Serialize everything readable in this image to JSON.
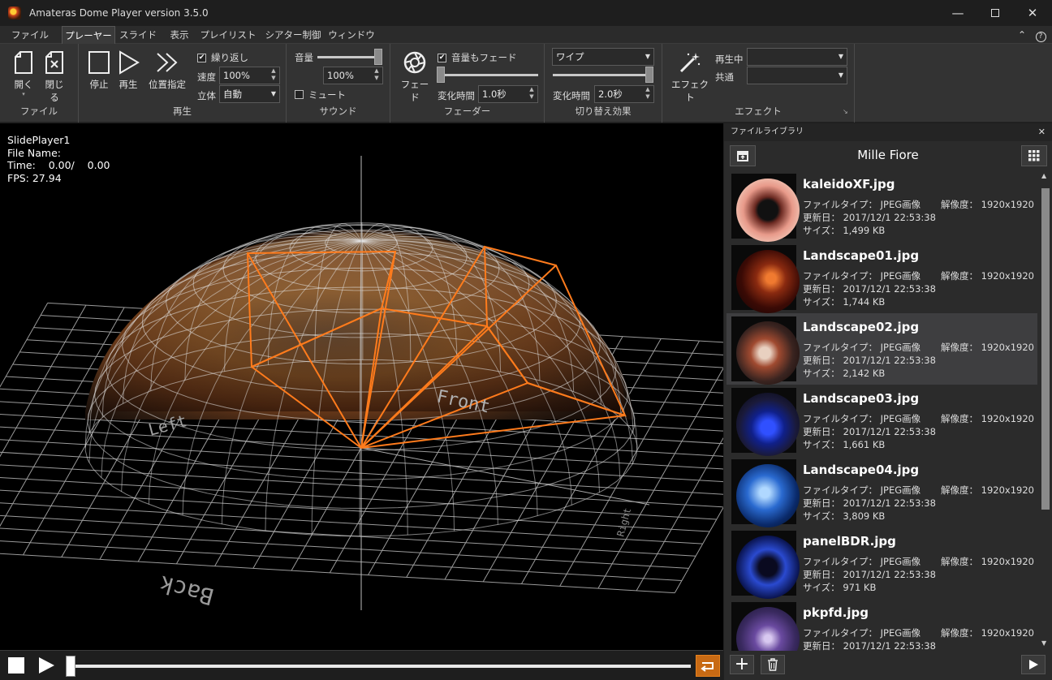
{
  "window": {
    "title": "Amateras Dome Player version 3.5.0",
    "minimize_icon": "minimize-icon",
    "maximize_icon": "maximize-icon",
    "close_icon": "close-icon"
  },
  "menu": {
    "tabs": [
      "ファイル",
      "プレーヤー",
      "スライド",
      "表示",
      "プレイリスト",
      "シアター制御",
      "ウィンドウ"
    ],
    "active": "プレーヤー"
  },
  "ribbon": {
    "file_group": {
      "label": "ファイル",
      "open": "開く",
      "close": "閉じる"
    },
    "play_group": {
      "label": "再生",
      "stop": "停止",
      "play": "再生",
      "seek": "位置指定",
      "loop": "繰り返し",
      "loop_checked": true,
      "speed_label": "速度",
      "speed_value": "100%",
      "stereo_label": "立体",
      "stereo_value": "自動"
    },
    "sound_group": {
      "label": "サウンド",
      "volume_label": "音量",
      "volume_value": "100%",
      "volume_level": 1.0,
      "mute": "ミュート",
      "mute_checked": false
    },
    "fader_group": {
      "label": "フェーダー",
      "fade": "フェード",
      "fade_volume": "音量もフェード",
      "fade_volume_checked": true,
      "time_label": "変化時間",
      "time_value": "1.0秒"
    },
    "transition_group": {
      "label": "切り替え効果",
      "effect_value": "ワイプ",
      "time_label": "変化時間",
      "time_value": "2.0秒"
    },
    "effect_group": {
      "label": "エフェクト",
      "effect": "エフェクト",
      "playing_label": "再生中",
      "common_label": "共通",
      "playing_value": "",
      "common_value": ""
    }
  },
  "player": {
    "name": "SlidePlayer1",
    "file_label": "File Name:",
    "time_label": "Time:",
    "time_current": "0.00/",
    "time_total": "0.00",
    "fps_label": "FPS:",
    "fps_value": "27.94",
    "dome_labels": {
      "front": "Front",
      "left": "Left",
      "back": "Back",
      "right": "Right"
    },
    "progress": 0.0
  },
  "library": {
    "panel_title": "ファイルライブラリ",
    "title": "Mille Fiore",
    "items": [
      {
        "name": "kaleidoXF.jpg",
        "type_label": "ファイルタイプ：",
        "type": "JPEG画像",
        "date_label": "更新日：",
        "date": "2017/12/1 22:53:38",
        "size_label": "サイズ：",
        "size": "1,499 KB",
        "res_label": "解像度：",
        "res": "1920x1920",
        "selected": false
      },
      {
        "name": "Landscape01.jpg",
        "type_label": "ファイルタイプ：",
        "type": "JPEG画像",
        "date_label": "更新日：",
        "date": "2017/12/1 22:53:38",
        "size_label": "サイズ：",
        "size": "1,744 KB",
        "res_label": "解像度：",
        "res": "1920x1920",
        "selected": false
      },
      {
        "name": "Landscape02.jpg",
        "type_label": "ファイルタイプ：",
        "type": "JPEG画像",
        "date_label": "更新日：",
        "date": "2017/12/1 22:53:38",
        "size_label": "サイズ：",
        "size": "2,142 KB",
        "res_label": "解像度：",
        "res": "1920x1920",
        "selected": true
      },
      {
        "name": "Landscape03.jpg",
        "type_label": "ファイルタイプ：",
        "type": "JPEG画像",
        "date_label": "更新日：",
        "date": "2017/12/1 22:53:38",
        "size_label": "サイズ：",
        "size": "1,661 KB",
        "res_label": "解像度：",
        "res": "1920x1920",
        "selected": false
      },
      {
        "name": "Landscape04.jpg",
        "type_label": "ファイルタイプ：",
        "type": "JPEG画像",
        "date_label": "更新日：",
        "date": "2017/12/1 22:53:38",
        "size_label": "サイズ：",
        "size": "3,809 KB",
        "res_label": "解像度：",
        "res": "1920x1920",
        "selected": false
      },
      {
        "name": "panelBDR.jpg",
        "type_label": "ファイルタイプ：",
        "type": "JPEG画像",
        "date_label": "更新日：",
        "date": "2017/12/1 22:53:38",
        "size_label": "サイズ：",
        "size": "971 KB",
        "res_label": "解像度：",
        "res": "1920x1920",
        "selected": false
      },
      {
        "name": "pkpfd.jpg",
        "type_label": "ファイルタイプ：",
        "type": "JPEG画像",
        "date_label": "更新日：",
        "date": "2017/12/1 22:53:38",
        "size_label": "サイズ：",
        "size": "",
        "res_label": "解像度：",
        "res": "1920x1920",
        "selected": false
      }
    ]
  },
  "colors": {
    "accent": "#e8821e",
    "bg": "#1f1f1f",
    "selected": "#3e3e40"
  }
}
